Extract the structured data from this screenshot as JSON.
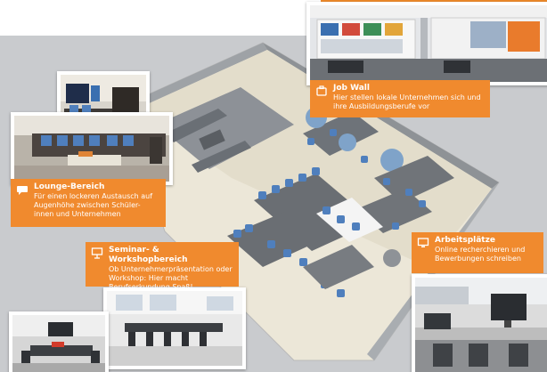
{
  "areas": {
    "job_wall": {
      "title": "Job Wall",
      "text": "Hier stellen lokale Unternehmen sich und ihre Ausbildungsberufe vor",
      "icon": "bag-icon"
    },
    "lounge": {
      "title": "Lounge-Bereich",
      "text": "Für einen lockeren Austausch auf Augenhöhe zwischen Schüler-innen und Unternehmen",
      "icon": "speech-bubble-icon"
    },
    "arbeitsplaetze": {
      "title": "Arbeitsplätze",
      "text": "Online recherchieren und Bewerbungen schreiben",
      "icon": "monitor-icon"
    },
    "seminar": {
      "title": "Seminar- & Workshopbereich",
      "text": "Ob Unternehmerpräsentation oder Workshop: Hier macht Berufserkundung Spaß!",
      "icon": "presentation-icon"
    }
  },
  "colors": {
    "accent": "#ee8a2a",
    "callout": "#f08a2e",
    "background": "#c9cbce"
  }
}
